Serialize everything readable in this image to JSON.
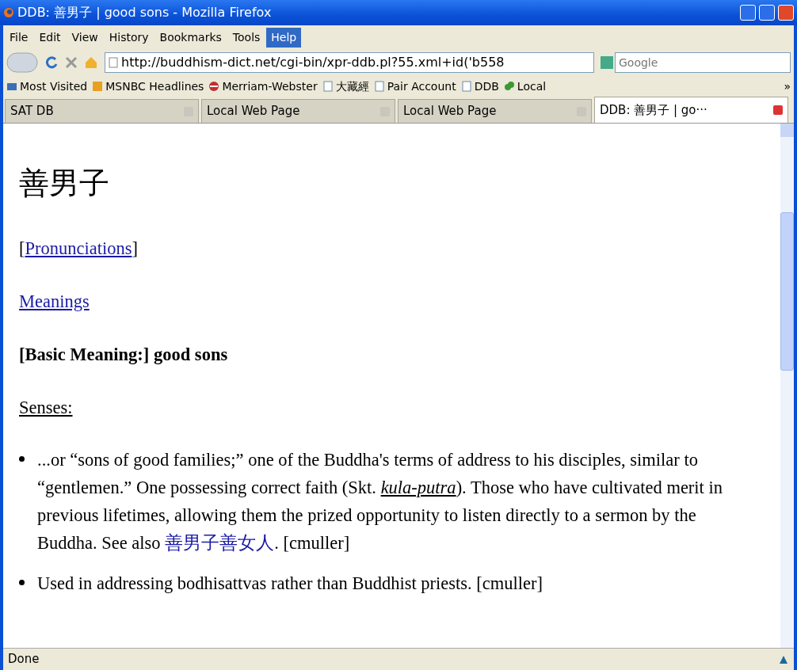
{
  "window": {
    "title": "DDB: 善男子 | good sons - Mozilla Firefox"
  },
  "menu": [
    {
      "label": "File",
      "selected": false
    },
    {
      "label": "Edit",
      "selected": false
    },
    {
      "label": "View",
      "selected": false
    },
    {
      "label": "History",
      "selected": false
    },
    {
      "label": "Bookmarks",
      "selected": false
    },
    {
      "label": "Tools",
      "selected": false
    },
    {
      "label": "Help",
      "selected": true
    }
  ],
  "address": {
    "value": "http://buddhism-dict.net/cgi-bin/xpr-ddb.pl?55.xml+id('b558"
  },
  "search": {
    "placeholder": "Google"
  },
  "bookmarks": [
    {
      "label": "Most Visited",
      "kind": "folder"
    },
    {
      "label": "MSNBC Headlines",
      "kind": "feed"
    },
    {
      "label": "Merriam-Webster",
      "kind": "site"
    },
    {
      "label": "大藏經",
      "kind": "page"
    },
    {
      "label": "Pair Account",
      "kind": "page"
    },
    {
      "label": "DDB",
      "kind": "page"
    },
    {
      "label": "Local",
      "kind": "leaf"
    }
  ],
  "bookmarks_more": "»",
  "tabs": [
    {
      "label": "SAT DB",
      "selected": false
    },
    {
      "label": "Local Web Page",
      "selected": false
    },
    {
      "label": "Local Web Page",
      "selected": false
    },
    {
      "label": "DDB: 善男子 | go···",
      "selected": true
    }
  ],
  "page": {
    "heading": "善男子",
    "pron_open": "[",
    "pronunciations": "Pronunciations",
    "pron_close": "]",
    "meanings": "Meanings",
    "basic_meaning": "[Basic Meaning:] good sons",
    "senses_label": "Senses:",
    "senses": [
      {
        "text_before": "...or “sons of good families;” one of the Buddha's terms of address to his disciples, similar to “gentlemen.” One possessing correct faith (Skt. ",
        "term": "kula-putra",
        "text_middle": "). Those who have cultivated merit in previous lifetimes, allowing them the prized opportunity to listen directly to a sermon by the Buddha. See also ",
        "link": "善男子善女人",
        "text_after": ". [cmuller]"
      },
      {
        "text_before": "Used in addressing bodhisattvas rather than Buddhist priests. [cmuller]"
      }
    ]
  },
  "status_bar": {
    "text": "Done"
  }
}
